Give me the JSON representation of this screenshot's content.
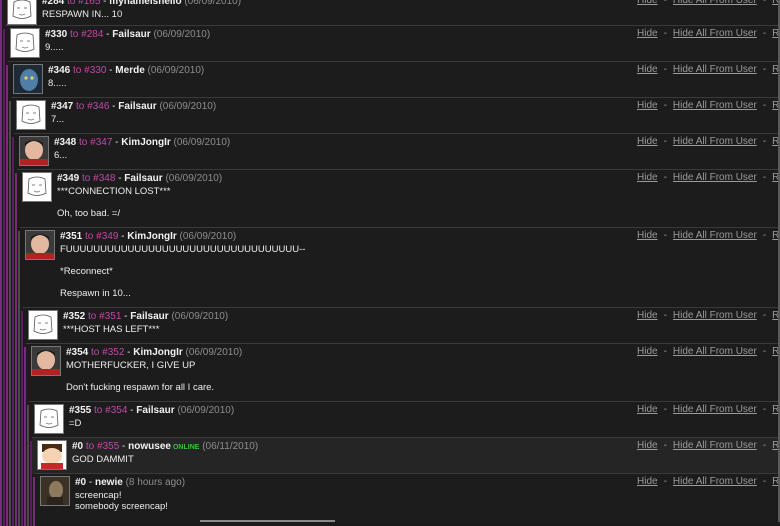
{
  "link_labels": {
    "hide": "Hide",
    "hide_all": "Hide All From User",
    "reply": "R"
  },
  "comments": [
    {
      "num": "#284",
      "to_label": " to #165",
      "author": "mynameishello",
      "date": "(06/09/2010)",
      "online": "",
      "lines": [
        "RESPAWN IN... 10"
      ],
      "avatar": "sketch-face"
    },
    {
      "num": "#330",
      "to_label": " to #284",
      "author": "Failsaur",
      "date": "(06/09/2010)",
      "online": "",
      "lines": [
        "9....."
      ],
      "avatar": "sketch-face"
    },
    {
      "num": "#346",
      "to_label": " to #330",
      "author": "Merde",
      "date": "(06/09/2010)",
      "online": "",
      "lines": [
        "8....."
      ],
      "avatar": "blue-face"
    },
    {
      "num": "#347",
      "to_label": " to #346",
      "author": "Failsaur",
      "date": "(06/09/2010)",
      "online": "",
      "lines": [
        "7..."
      ],
      "avatar": "sketch-face"
    },
    {
      "num": "#348",
      "to_label": " to #347",
      "author": "KimJongIr",
      "date": "(06/09/2010)",
      "online": "",
      "lines": [
        "6..."
      ],
      "avatar": "photo-face"
    },
    {
      "num": "#349",
      "to_label": " to #348",
      "author": "Failsaur",
      "date": "(06/09/2010)",
      "online": "",
      "lines": [
        "***CONNECTION LOST***",
        "",
        "Oh, too bad. =/"
      ],
      "avatar": "sketch-face"
    },
    {
      "num": "#351",
      "to_label": " to #349",
      "author": "KimJongIr",
      "date": "(06/09/2010)",
      "online": "",
      "lines": [
        "FUUUUUUUUUUUUUUUUUUUUUUUUUUUUUUUUUU--",
        "",
        "*Reconnect*",
        "",
        "Respawn in 10..."
      ],
      "avatar": "photo-face"
    },
    {
      "num": "#352",
      "to_label": " to #351",
      "author": "Failsaur",
      "date": "(06/09/2010)",
      "online": "",
      "lines": [
        "***HOST HAS LEFT***"
      ],
      "avatar": "sketch-face"
    },
    {
      "num": "#354",
      "to_label": " to #352",
      "author": "KimJongIr",
      "date": "(06/09/2010)",
      "online": "",
      "lines": [
        "MOTHERFUCKER, I GIVE UP",
        "",
        "Don't fucking respawn for all I care."
      ],
      "avatar": "photo-face"
    },
    {
      "num": "#355",
      "to_label": " to #354",
      "author": "Failsaur",
      "date": "(06/09/2010)",
      "online": "",
      "lines": [
        "=D"
      ],
      "avatar": "sketch-face"
    },
    {
      "num": "#0",
      "to_label": " to #355",
      "author": "nowusee",
      "date": "(06/11/2010)",
      "online": "ONLINE",
      "lines": [
        "GOD DAMMIT"
      ],
      "avatar": "cartoon-face"
    },
    {
      "num": "#0",
      "to_label": "",
      "author": "newie",
      "date": "(8 hours ago)",
      "online": "",
      "lines": [
        "screencap!",
        "somebody screencap!"
      ],
      "avatar": "dark-photo"
    }
  ],
  "colors": {
    "background": "#1b1b1b",
    "reply_link": "#c04aa8",
    "online": "#39c239",
    "thread_stripe": "#6b1f6b"
  }
}
